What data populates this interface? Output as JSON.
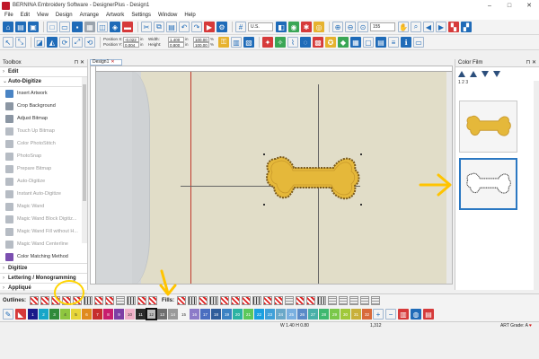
{
  "window": {
    "title": "BERNINA Embroidery Software - DesignerPlus - Design1",
    "minimize": "–",
    "maximize": "□",
    "close": "✕"
  },
  "menu": [
    "File",
    "Edit",
    "View",
    "Design",
    "Arrange",
    "Artwork",
    "Settings",
    "Window",
    "Help"
  ],
  "toolbar": {
    "position_x_label": "Position X:",
    "position_x": "-0.022",
    "position_y_label": "Position Y:",
    "position_y": "0.004",
    "width_label": "Width:",
    "width": "1.400",
    "height_label": "Height:",
    "height": "0.800",
    "unit": "in",
    "scale_w": "100.00",
    "scale_h": "100.00",
    "pct": "%",
    "hoop_unit": "U.S.",
    "zoom": "155"
  },
  "toolbox": {
    "title": "Toolbox",
    "pin": "⊓ ✕",
    "sections": {
      "edit": "Edit",
      "auto_digitize": "Auto-Digitize"
    },
    "tools": [
      "Insert Artwork",
      "Crop Background",
      "Adjust Bitmap",
      "Touch Up Bitmap",
      "Color PhotoStitch",
      "PhotoSnap",
      "Prepare Bitmap",
      "Auto-Digitize",
      "Instant Auto-Digitize",
      "Magic Wand",
      "Magic Wand Block Digitiz...",
      "Magic Wand Fill without H...",
      "Magic Wand Centerline",
      "Color Matching Method"
    ],
    "lower_sections": [
      "Digitize",
      "Lettering / Monogramming",
      "Appliqué"
    ]
  },
  "design_tab": {
    "label": "Design1",
    "close": "✕"
  },
  "color_film": {
    "title": "Color Film",
    "pin": "⊓ ✕",
    "sequence": "1 2 3"
  },
  "outlines_label": "Outlines:",
  "fills_label": "Fills:",
  "colors": {
    "swatches": [
      {
        "n": "1",
        "c": "#1a1a8a"
      },
      {
        "n": "2",
        "c": "#18a6c8"
      },
      {
        "n": "3",
        "c": "#2f8a3a"
      },
      {
        "n": "4",
        "c": "#8ec63f"
      },
      {
        "n": "5",
        "c": "#e7d53a"
      },
      {
        "n": "6",
        "c": "#e08a1e"
      },
      {
        "n": "7",
        "c": "#c62e2e"
      },
      {
        "n": "8",
        "c": "#c81e6e"
      },
      {
        "n": "9",
        "c": "#7e3fa5"
      },
      {
        "n": "10",
        "c": "#f0b0c8"
      },
      {
        "n": "11",
        "c": "#2a2a2a"
      },
      {
        "n": "12",
        "c": "#bcbcbc"
      },
      {
        "n": "13",
        "c": "#6e6e6e"
      },
      {
        "n": "14",
        "c": "#9a9a9a"
      },
      {
        "n": "15",
        "c": "#f4f4f4"
      },
      {
        "n": "16",
        "c": "#8c7ac8"
      },
      {
        "n": "17",
        "c": "#4a6ec0"
      },
      {
        "n": "18",
        "c": "#2f5d9a"
      },
      {
        "n": "19",
        "c": "#3b82c4"
      },
      {
        "n": "20",
        "c": "#2bb3a3"
      },
      {
        "n": "21",
        "c": "#5bc85b"
      },
      {
        "n": "22",
        "c": "#1aa0e0"
      },
      {
        "n": "23",
        "c": "#3fa0d8"
      },
      {
        "n": "24",
        "c": "#6aa8c8"
      },
      {
        "n": "25",
        "c": "#7ab0e0"
      },
      {
        "n": "26",
        "c": "#5a8ac8"
      },
      {
        "n": "27",
        "c": "#48b0a8"
      },
      {
        "n": "28",
        "c": "#3fb870"
      },
      {
        "n": "29",
        "c": "#7ac84a"
      },
      {
        "n": "30",
        "c": "#a0c83a"
      },
      {
        "n": "31",
        "c": "#c8b03a"
      },
      {
        "n": "32",
        "c": "#d86a3a"
      }
    ],
    "selected_index": 11
  },
  "status": {
    "wh": "W 1.40 H 0.80",
    "stitches": "1,312",
    "grade": "ART Grade: A"
  },
  "accent": {
    "bone_fill": "#e5b83a",
    "bone_stitch": "#8a6a22",
    "annotation": "#ffd400"
  }
}
